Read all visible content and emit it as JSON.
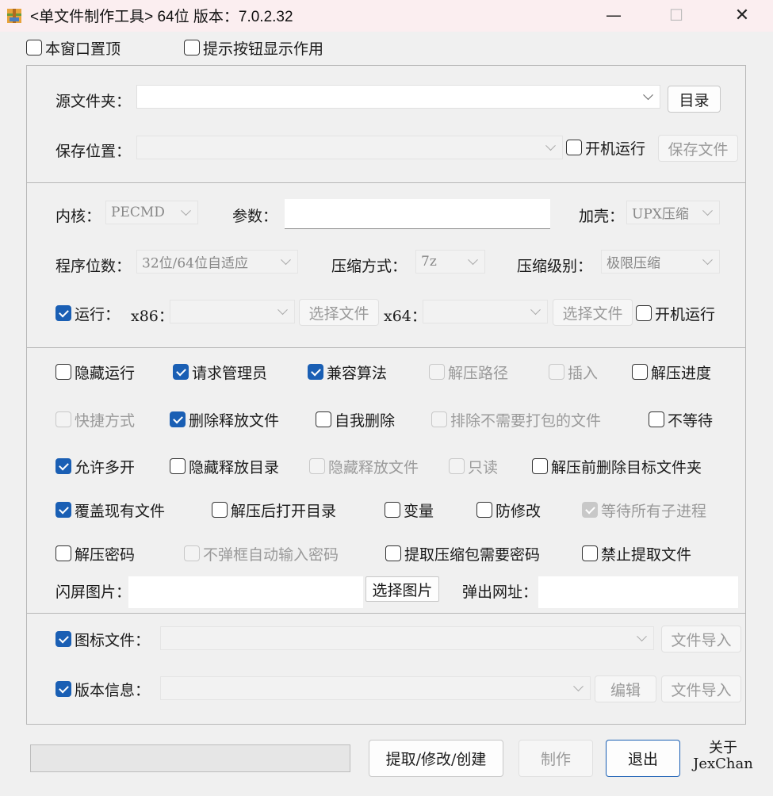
{
  "window": {
    "title": "<单文件制作工具> 64位 版本：7.0.2.32",
    "minimize": "—",
    "maximize": "☐",
    "close": "✕"
  },
  "top_options": {
    "always_on_top": {
      "label": "本窗口置顶",
      "checked": false
    },
    "tooltip_help": {
      "label": "提示按钮显示作用",
      "checked": false
    }
  },
  "source": {
    "label": "源文件夹：",
    "value": "",
    "browse_button": "目录"
  },
  "save": {
    "label": "保存位置：",
    "value": "",
    "run_on_boot": {
      "label": "开机运行",
      "checked": false
    },
    "save_button": "保存文件"
  },
  "core": {
    "kernel_label": "内核：",
    "kernel_value": "PECMD",
    "params_label": "参数：",
    "params_value": "",
    "shell_label": "加壳：",
    "shell_value": "UPX压缩",
    "bits_label": "程序位数：",
    "bits_value": "32位/64位自适应",
    "compress_method_label": "压缩方式：",
    "compress_method_value": "7z",
    "compress_level_label": "压缩级别：",
    "compress_level_value": "极限压缩",
    "run": {
      "label": "运行：",
      "checked": true
    },
    "x86_label": "x86：",
    "x86_value": "",
    "x86_button": "选择文件",
    "x64_label": "x64：",
    "x64_value": "",
    "x64_button": "选择文件",
    "run_on_boot": {
      "label": "开机运行",
      "checked": false
    }
  },
  "options": [
    {
      "id": "hide-run",
      "label": "隐藏运行",
      "checked": false,
      "disabled": false
    },
    {
      "id": "request-admin",
      "label": "请求管理员",
      "checked": true,
      "disabled": false
    },
    {
      "id": "compat-algo",
      "label": "兼容算法",
      "checked": true,
      "disabled": false
    },
    {
      "id": "extract-path",
      "label": "解压路径",
      "checked": false,
      "disabled": true
    },
    {
      "id": "insert",
      "label": "插入",
      "checked": false,
      "disabled": true
    },
    {
      "id": "extract-progress",
      "label": "解压进度",
      "checked": false,
      "disabled": false
    },
    {
      "id": "shortcut",
      "label": "快捷方式",
      "checked": false,
      "disabled": true
    },
    {
      "id": "delete-released",
      "label": "删除释放文件",
      "checked": true,
      "disabled": false
    },
    {
      "id": "self-delete",
      "label": "自我删除",
      "checked": false,
      "disabled": false
    },
    {
      "id": "exclude-files",
      "label": "排除不需要打包的文件",
      "checked": false,
      "disabled": true
    },
    {
      "id": "no-wait",
      "label": "不等待",
      "checked": false,
      "disabled": false
    },
    {
      "id": "allow-multi",
      "label": "允许多开",
      "checked": true,
      "disabled": false
    },
    {
      "id": "hide-release-dir",
      "label": "隐藏释放目录",
      "checked": false,
      "disabled": false
    },
    {
      "id": "hide-release-files",
      "label": "隐藏释放文件",
      "checked": false,
      "disabled": true
    },
    {
      "id": "read-only",
      "label": "只读",
      "checked": false,
      "disabled": true
    },
    {
      "id": "delete-target-before",
      "label": "解压前删除目标文件夹",
      "checked": false,
      "disabled": false
    },
    {
      "id": "overwrite",
      "label": "覆盖现有文件",
      "checked": true,
      "disabled": false
    },
    {
      "id": "open-dir-after",
      "label": "解压后打开目录",
      "checked": false,
      "disabled": false
    },
    {
      "id": "variables",
      "label": "变量",
      "checked": false,
      "disabled": false
    },
    {
      "id": "anti-modify",
      "label": "防修改",
      "checked": false,
      "disabled": false
    },
    {
      "id": "wait-children",
      "label": "等待所有子进程",
      "checked": true,
      "disabled": true
    },
    {
      "id": "extract-password",
      "label": "解压密码",
      "checked": false,
      "disabled": false
    },
    {
      "id": "auto-password",
      "label": "不弹框自动输入密码",
      "checked": false,
      "disabled": true
    },
    {
      "id": "extract-need-password",
      "label": "提取压缩包需要密码",
      "checked": false,
      "disabled": false
    },
    {
      "id": "forbid-extract",
      "label": "禁止提取文件",
      "checked": false,
      "disabled": false
    }
  ],
  "splash": {
    "label": "闪屏图片：",
    "value": "",
    "button": "选择图片",
    "popup_url_label": "弹出网址：",
    "popup_url_value": ""
  },
  "icon_file": {
    "label": "图标文件：",
    "checked": true,
    "value": "",
    "import_button": "文件导入"
  },
  "version_info": {
    "label": "版本信息：",
    "checked": true,
    "value": "",
    "edit_button": "编辑",
    "import_button": "文件导入"
  },
  "footer": {
    "progress": 0,
    "extract_button": "提取/修改/创建",
    "build_button": "制作",
    "exit_button": "退出",
    "about_line1": "关于",
    "about_line2": "JexChan"
  }
}
